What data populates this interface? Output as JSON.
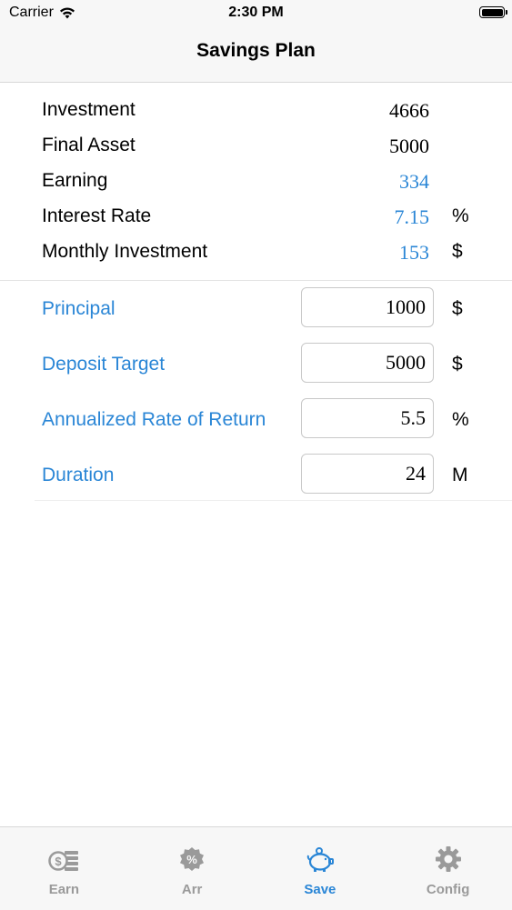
{
  "status_bar": {
    "carrier": "Carrier",
    "time": "2:30 PM"
  },
  "nav": {
    "title": "Savings Plan"
  },
  "results": [
    {
      "label": "Investment",
      "value": "4666",
      "unit": "",
      "color": "#000000"
    },
    {
      "label": "Final Asset",
      "value": "5000",
      "unit": "",
      "color": "#000000"
    },
    {
      "label": "Earning",
      "value": "334",
      "unit": "",
      "color": "#2a86d6"
    },
    {
      "label": "Interest Rate",
      "value": "7.15",
      "unit": "%",
      "color": "#2a86d6"
    },
    {
      "label": "Monthly Investment",
      "value": "153",
      "unit": "$",
      "color": "#2a86d6"
    }
  ],
  "inputs": [
    {
      "label": "Principal",
      "value": "1000",
      "unit": "$"
    },
    {
      "label": "Deposit Target",
      "value": "5000",
      "unit": "$"
    },
    {
      "label": "Annualized Rate of Return",
      "value": "5.5",
      "unit": "%"
    },
    {
      "label": "Duration",
      "value": "24",
      "unit": "M"
    }
  ],
  "tabs": [
    {
      "label": "Earn",
      "icon": "coins-icon",
      "active": false
    },
    {
      "label": "Arr",
      "icon": "percent-badge-icon",
      "active": false
    },
    {
      "label": "Save",
      "icon": "piggy-bank-icon",
      "active": true
    },
    {
      "label": "Config",
      "icon": "gear-icon",
      "active": false
    }
  ],
  "colors": {
    "accent": "#2a86d6",
    "inactive_tab": "#9a9a9a"
  }
}
